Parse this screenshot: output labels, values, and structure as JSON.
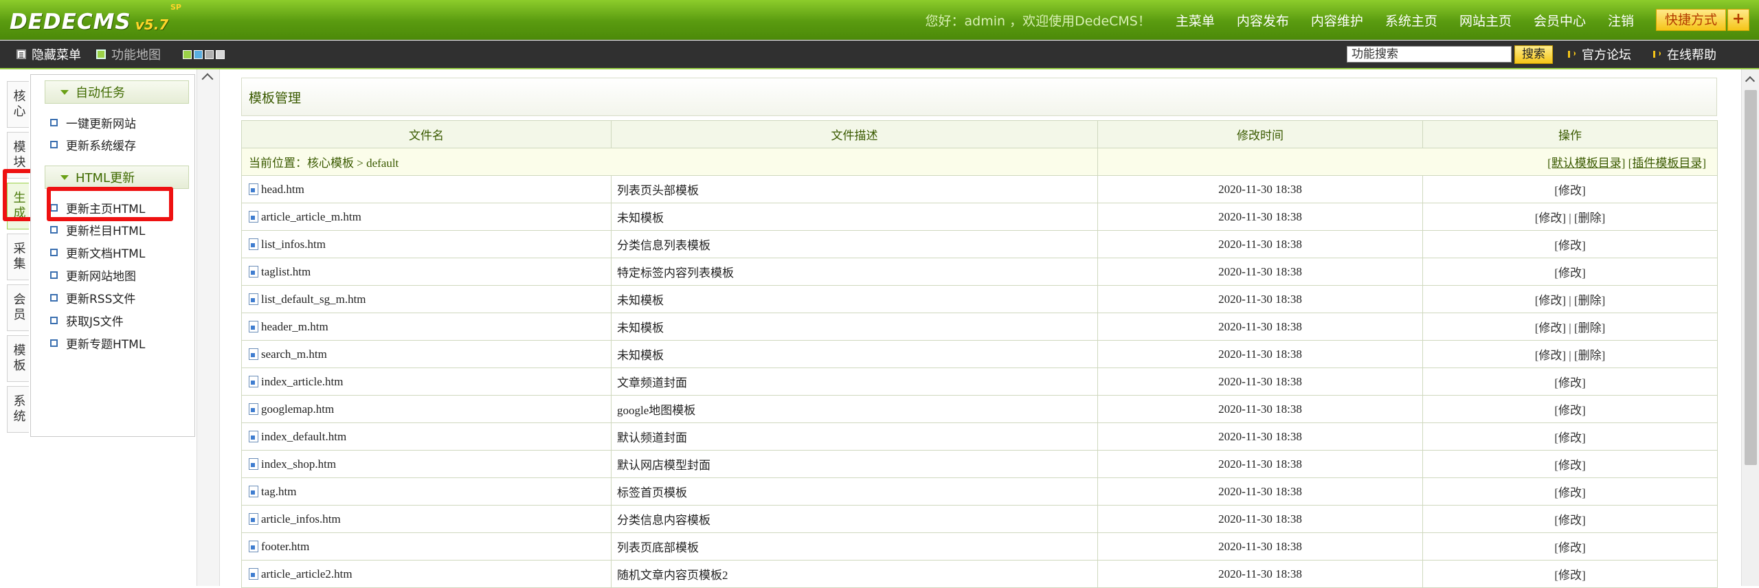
{
  "header": {
    "logo_text": "DEDECMS",
    "logo_version": "v5.7",
    "logo_edition": "SP",
    "welcome": "您好：admin ，欢迎使用DedeCMS！",
    "nav": [
      "主菜单",
      "内容发布",
      "内容维护",
      "系统主页",
      "网站主页",
      "会员中心",
      "注销"
    ],
    "quick_label": "快捷方式",
    "quick_add": "+"
  },
  "toolbar": {
    "hide_menu": "隐藏菜单",
    "func_map": "功能地图",
    "search_placeholder": "功能搜索",
    "search_button": "搜索",
    "forum": "官方论坛",
    "help": "在线帮助",
    "skin_colors": [
      "#9bd148",
      "#5aaee0",
      "#b0b0b0",
      "#d8d8d8"
    ]
  },
  "left_tabs": [
    "核心",
    "模块",
    "生成",
    "采集",
    "会员",
    "模板",
    "系统"
  ],
  "submenu": {
    "groups": [
      {
        "title": "自动任务",
        "items": [
          "一键更新网站",
          "更新系统缓存"
        ]
      },
      {
        "title": "HTML更新",
        "items": [
          "更新主页HTML",
          "更新栏目HTML",
          "更新文档HTML",
          "更新网站地图",
          "更新RSS文件",
          "获取JS文件",
          "更新专题HTML"
        ]
      }
    ]
  },
  "main": {
    "title": "模板管理",
    "columns": [
      "文件名",
      "文件描述",
      "修改时间",
      "操作"
    ],
    "location": "当前位置：核心模板 > default",
    "default_dir": "[默认模板目录]",
    "plugin_dir": "[插件模板目录]",
    "rows": [
      {
        "file": "head.htm",
        "desc": "列表页头部模板",
        "time": "2020-11-30 18:38",
        "ops": "[修改]"
      },
      {
        "file": "article_article_m.htm",
        "desc": "未知模板",
        "time": "2020-11-30 18:38",
        "ops": "[修改] | [删除]"
      },
      {
        "file": "list_infos.htm",
        "desc": "分类信息列表模板",
        "time": "2020-11-30 18:38",
        "ops": "[修改]"
      },
      {
        "file": "taglist.htm",
        "desc": "特定标签内容列表模板",
        "time": "2020-11-30 18:38",
        "ops": "[修改]"
      },
      {
        "file": "list_default_sg_m.htm",
        "desc": "未知模板",
        "time": "2020-11-30 18:38",
        "ops": "[修改] | [删除]"
      },
      {
        "file": "header_m.htm",
        "desc": "未知模板",
        "time": "2020-11-30 18:38",
        "ops": "[修改] | [删除]"
      },
      {
        "file": "search_m.htm",
        "desc": "未知模板",
        "time": "2020-11-30 18:38",
        "ops": "[修改] | [删除]"
      },
      {
        "file": "index_article.htm",
        "desc": "文章频道封面",
        "time": "2020-11-30 18:38",
        "ops": "[修改]"
      },
      {
        "file": "googlemap.htm",
        "desc": "google地图模板",
        "time": "2020-11-30 18:38",
        "ops": "[修改]"
      },
      {
        "file": "index_default.htm",
        "desc": "默认频道封面",
        "time": "2020-11-30 18:38",
        "ops": "[修改]"
      },
      {
        "file": "index_shop.htm",
        "desc": "默认网店模型封面",
        "time": "2020-11-30 18:38",
        "ops": "[修改]"
      },
      {
        "file": "tag.htm",
        "desc": "标签首页模板",
        "time": "2020-11-30 18:38",
        "ops": "[修改]"
      },
      {
        "file": "article_infos.htm",
        "desc": "分类信息内容模板",
        "time": "2020-11-30 18:38",
        "ops": "[修改]"
      },
      {
        "file": "footer.htm",
        "desc": "列表页底部模板",
        "time": "2020-11-30 18:38",
        "ops": "[修改]"
      },
      {
        "file": "article_article2.htm",
        "desc": "随机文章内容页模板2",
        "time": "2020-11-30 18:38",
        "ops": "[修改]"
      }
    ]
  }
}
